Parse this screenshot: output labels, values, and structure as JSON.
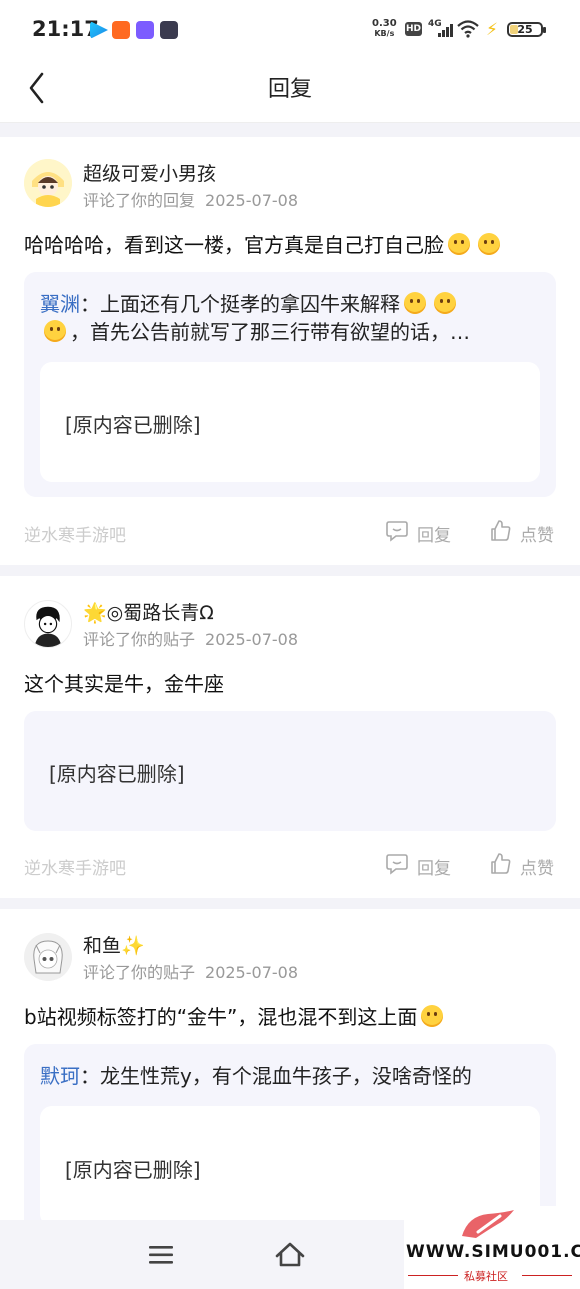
{
  "status_bar": {
    "time": "21:17",
    "speed_value": "0.30",
    "speed_unit": "KB/s",
    "hd": "HD",
    "network": "4G",
    "battery": "25",
    "app_icon_colors": [
      "#1e88e5",
      "#ff6a21",
      "#7c5cff",
      "#3b3b4f"
    ]
  },
  "header": {
    "title": "回复"
  },
  "cards": [
    {
      "user": "超级可爱小男孩",
      "action": "评论了你的回复",
      "date": "2025-07-08",
      "content": "哈哈哈哈，看到这一楼，官方真是自己打自己脸",
      "quote_name": "翼渊",
      "quote_line1": "：上面还有几个挺孝的拿囚牛来解释",
      "quote_line2": "，首先公告前就写了那三行带有欲望的话，…",
      "deleted": "[原内容已删除]",
      "forum": "逆水寒手游吧",
      "reply_label": "回复",
      "like_label": "点赞"
    },
    {
      "user": "🌟◎蜀路长青Ω",
      "action": "评论了你的贴子",
      "date": "2025-07-08",
      "content": "这个其实是牛，金牛座",
      "deleted": "[原内容已删除]",
      "forum": "逆水寒手游吧",
      "reply_label": "回复",
      "like_label": "点赞"
    },
    {
      "user": "和鱼✨",
      "action": "评论了你的贴子",
      "date": "2025-07-08",
      "content": "b站视频标签打的“金牛”，混也混不到这上面",
      "quote_name": "默珂",
      "quote_line1": "：龙生性荒y，有个混血牛孩子，没啥奇怪的",
      "deleted": "[原内容已删除]"
    }
  ],
  "watermark": {
    "url": "WWW.SIMU001.CN",
    "sub": "私募社区"
  },
  "colors": {
    "accent": "#3a6fc4",
    "quote_bg": "#f5f5fc",
    "page_bg": "#f3f3f8"
  }
}
